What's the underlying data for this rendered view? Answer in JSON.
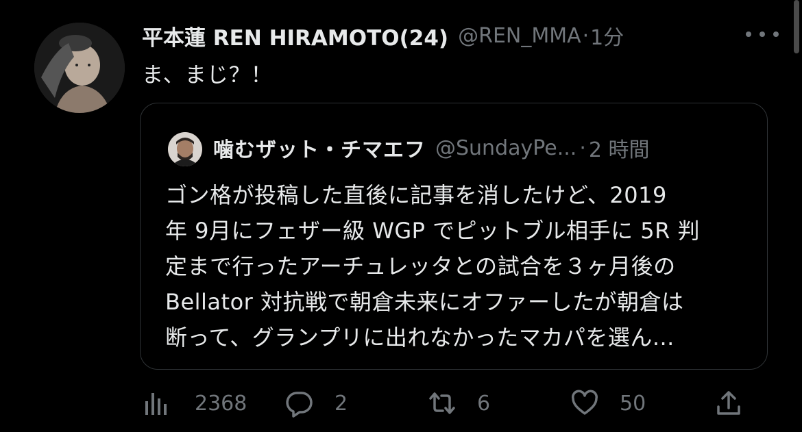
{
  "tweet": {
    "display_name": "平本蓮 REN HIRAMOTO(24)",
    "handle": "@REN_MMA",
    "separator": "·",
    "time": "1分",
    "text": "ま、まじ？！"
  },
  "quoted": {
    "display_name": "噛むザット・チマエフ",
    "handle": "@SundayPe...",
    "separator": "·",
    "time": "2 時間",
    "text": "ゴン格が投稿した直後に記事を消したけど、2019\n年 9月にフェザー級 WGP でピットブル相手に 5R 判\n定まで行ったアーチュレッタとの試合を３ヶ月後の\nBellator 対抗戦で朝倉未来にオファーしたが朝倉は\n断って、グランプリに出れなかったマカパを選ん..."
  },
  "actions": {
    "views": "2368",
    "replies": "2",
    "retweets": "6",
    "likes": "50"
  },
  "icons": {
    "more": "more-horizontal-icon",
    "views": "analytics-icon",
    "reply": "reply-icon",
    "retweet": "retweet-icon",
    "like": "heart-icon",
    "share": "share-icon"
  },
  "colors": {
    "background": "#000000",
    "text": "#e7e9ea",
    "secondary": "#71767b",
    "border": "#2f3336"
  }
}
